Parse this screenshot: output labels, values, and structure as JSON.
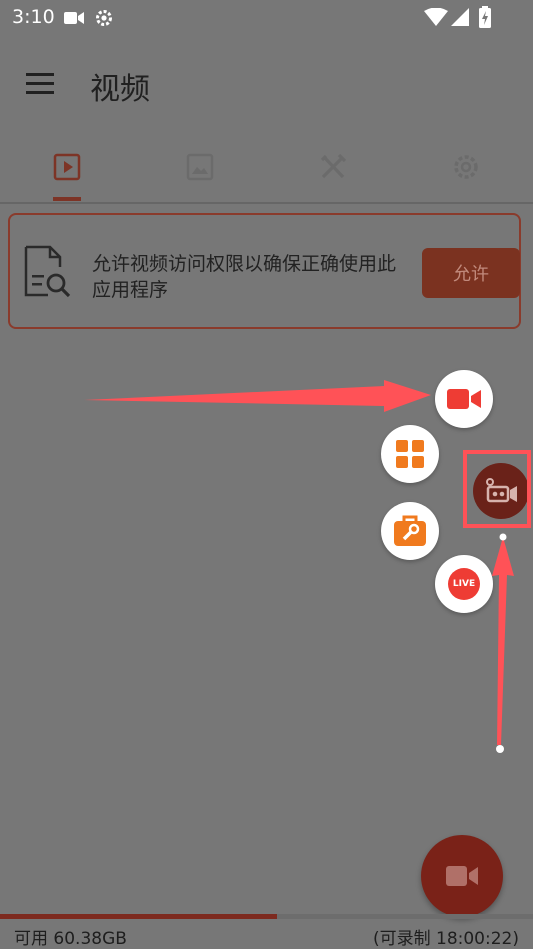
{
  "status_bar": {
    "time": "3:10",
    "icons": [
      "video-camera-icon",
      "settings-icon",
      "wifi-icon",
      "signal-icon",
      "battery-icon"
    ]
  },
  "app_bar": {
    "title": "视频",
    "menu_icon": "hamburger-menu-icon"
  },
  "tabs": [
    {
      "icon": "video-play-icon",
      "selected": true
    },
    {
      "icon": "image-icon",
      "selected": false
    },
    {
      "icon": "tools-icon",
      "selected": false
    },
    {
      "icon": "settings-icon",
      "selected": false
    }
  ],
  "permission_card": {
    "icon": "document-search-icon",
    "message": "允许视频访问权限以确保正确使用此应用程序",
    "button_label": "允许"
  },
  "floating_menu": {
    "items": [
      {
        "name": "record",
        "icon": "video-camera-icon",
        "color": "#ee3c34"
      },
      {
        "name": "tools-grid",
        "icon": "grid-icon",
        "color": "#f07a1e"
      },
      {
        "name": "toolbox",
        "icon": "toolbox-icon",
        "color": "#f07a1e"
      },
      {
        "name": "live",
        "icon": "live-badge-icon",
        "label": "LIVE",
        "color": "#ee3c34"
      }
    ],
    "floating_button_icon": "camera-recorder-icon"
  },
  "main_fab": {
    "icon": "video-camera-icon"
  },
  "storage": {
    "available": "可用 60.38GB",
    "record_time": "(可录制 18:00:22)",
    "used_fraction": 0.52
  },
  "colors": {
    "accent": "#7d2a1f",
    "annotation": "#ff5257",
    "background_dimmed": "#777777"
  }
}
